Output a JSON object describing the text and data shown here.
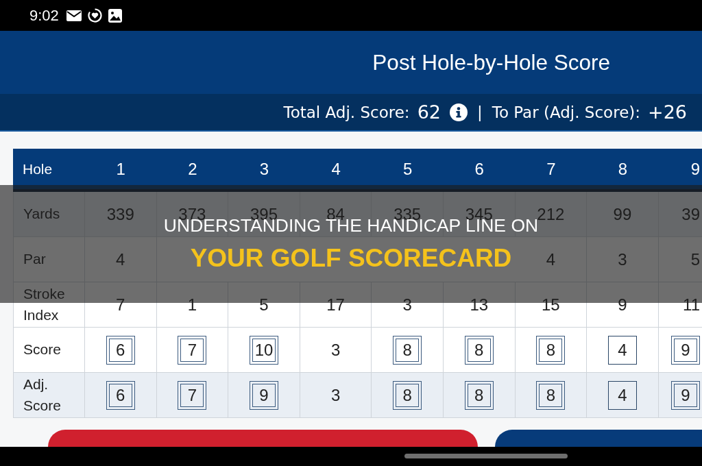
{
  "status_bar": {
    "time": "9:02"
  },
  "header": {
    "title": "Post Hole-by-Hole Score"
  },
  "summary": {
    "total_label": "Total Adj. Score:",
    "total_value": "62",
    "separator": "|",
    "to_par_label": "To Par (Adj. Score):",
    "to_par_value": "+26"
  },
  "scorecard": {
    "corner_label": "Hole",
    "columns": [
      "1",
      "2",
      "3",
      "4",
      "5",
      "6",
      "7",
      "8",
      "9"
    ],
    "rows": [
      {
        "label": "Yards",
        "cells": [
          {
            "value": "339",
            "kind": "plain"
          },
          {
            "value": "373",
            "kind": "plain"
          },
          {
            "value": "395",
            "kind": "plain"
          },
          {
            "value": "84",
            "kind": "plain"
          },
          {
            "value": "335",
            "kind": "plain"
          },
          {
            "value": "345",
            "kind": "plain"
          },
          {
            "value": "212",
            "kind": "plain"
          },
          {
            "value": "99",
            "kind": "plain"
          },
          {
            "value": "39",
            "kind": "plain"
          }
        ]
      },
      {
        "label": "Par",
        "cells": [
          {
            "value": "4",
            "kind": "plain"
          },
          {
            "kind": "plain"
          },
          {
            "kind": "plain"
          },
          {
            "kind": "plain"
          },
          {
            "kind": "plain"
          },
          {
            "kind": "plain"
          },
          {
            "value": "4",
            "kind": "plain"
          },
          {
            "value": "3",
            "kind": "plain"
          },
          {
            "value": "5",
            "kind": "plain"
          }
        ]
      },
      {
        "label": "Stroke Index",
        "cells": [
          {
            "value": "7",
            "kind": "plain"
          },
          {
            "value": "1",
            "kind": "plain"
          },
          {
            "value": "5",
            "kind": "plain"
          },
          {
            "value": "17",
            "kind": "plain"
          },
          {
            "value": "3",
            "kind": "plain"
          },
          {
            "value": "13",
            "kind": "plain"
          },
          {
            "value": "15",
            "kind": "plain"
          },
          {
            "value": "9",
            "kind": "plain"
          },
          {
            "value": "11",
            "kind": "plain"
          }
        ]
      },
      {
        "label": "Score",
        "cells": [
          {
            "value": "6",
            "kind": "double-box"
          },
          {
            "value": "7",
            "kind": "double-box"
          },
          {
            "value": "10",
            "kind": "double-box"
          },
          {
            "value": "3",
            "kind": "plain"
          },
          {
            "value": "8",
            "kind": "double-box"
          },
          {
            "value": "8",
            "kind": "double-box"
          },
          {
            "value": "8",
            "kind": "double-box"
          },
          {
            "value": "4",
            "kind": "single-box"
          },
          {
            "value": "9",
            "kind": "double-box"
          }
        ]
      },
      {
        "label": "Adj. Score",
        "cells": [
          {
            "value": "6",
            "kind": "double-box"
          },
          {
            "value": "7",
            "kind": "double-box"
          },
          {
            "value": "9",
            "kind": "double-box"
          },
          {
            "value": "3",
            "kind": "plain"
          },
          {
            "value": "8",
            "kind": "double-box"
          },
          {
            "value": "8",
            "kind": "double-box"
          },
          {
            "value": "8",
            "kind": "double-box"
          },
          {
            "value": "4",
            "kind": "single-box"
          },
          {
            "value": "9",
            "kind": "double-box"
          }
        ]
      }
    ]
  },
  "banner": {
    "lines": [
      {
        "text": "UNDERSTANDING THE HANDICAP LINE ON",
        "kind": "kicker"
      },
      {
        "text": "YOUR GOLF SCORECARD",
        "kind": "headline"
      }
    ]
  }
}
